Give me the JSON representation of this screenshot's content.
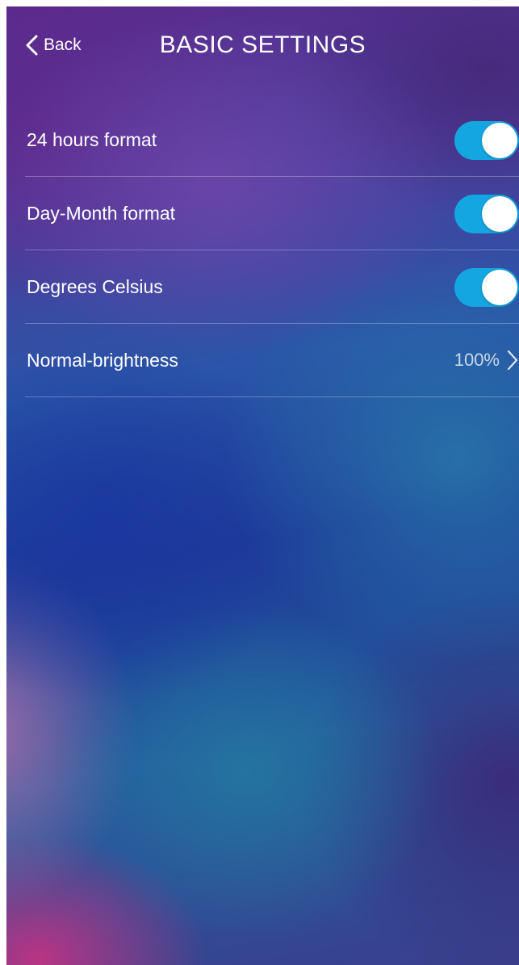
{
  "header": {
    "back_label": "Back",
    "title": "BASIC SETTINGS"
  },
  "settings": [
    {
      "label": "24 hours format",
      "type": "toggle",
      "on": true
    },
    {
      "label": "Day-Month format",
      "type": "toggle",
      "on": true
    },
    {
      "label": "Degrees Celsius",
      "type": "toggle",
      "on": true
    },
    {
      "label": "Normal-brightness",
      "type": "value",
      "value": "100%"
    }
  ],
  "colors": {
    "toggle_on": "#14a6e0",
    "text": "#ffffff"
  },
  "icons": {
    "back": "chevron-left-icon",
    "disclosure": "chevron-right-icon"
  }
}
